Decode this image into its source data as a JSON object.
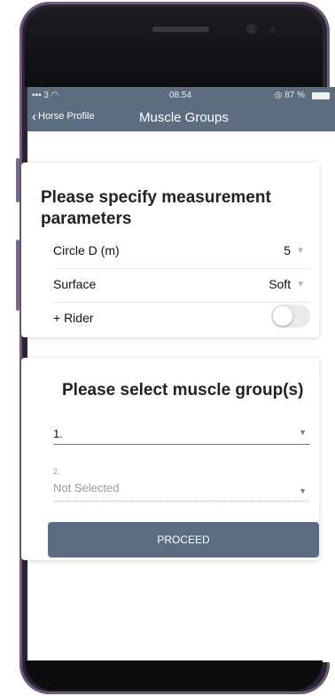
{
  "status_bar": {
    "signal": "3",
    "time": "08.54",
    "battery": "87 %"
  },
  "nav": {
    "back_label": "Horse Profile",
    "title": "Muscle Groups"
  },
  "measurement_card": {
    "title_line1": "Please specify measurement",
    "title_line2": "parameters",
    "circle": {
      "label": "Circle D (m)",
      "value": "5"
    },
    "surface": {
      "label": "Surface",
      "value": "Soft"
    },
    "rider": {
      "label": "+ Rider",
      "enabled": false
    }
  },
  "muscle_card": {
    "title": "Please select muscle group(s)",
    "select1": {
      "value": "1."
    },
    "select2": {
      "label": "2.",
      "value": "Not Selected"
    },
    "proceed_label": "PROCEED"
  },
  "colors": {
    "accent": "#5b6d7f"
  }
}
